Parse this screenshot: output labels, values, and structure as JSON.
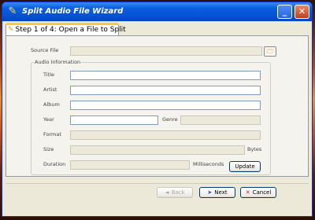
{
  "window": {
    "title": "Split Audio File Wizard",
    "controls": {
      "minimize": "_",
      "close": "✕"
    }
  },
  "tab": {
    "label": "Step 1 of 4:  Open a File to Split"
  },
  "source": {
    "label": "Source File",
    "value": ""
  },
  "audio_info": {
    "group_label": "Audio Information",
    "title_label": "Title",
    "title_value": "",
    "artist_label": "Artist",
    "artist_value": "",
    "album_label": "Album",
    "album_value": "",
    "year_label": "Year",
    "year_value": "",
    "genre_label": "Genre",
    "genre_value": "",
    "format_label": "Format",
    "format_value": "",
    "size_label": "Size",
    "size_value": "",
    "size_unit": "Bytes",
    "duration_label": "Duration",
    "duration_value": "",
    "duration_unit": "Milliseconds",
    "update_label": "Update"
  },
  "footer": {
    "back_label": "Back",
    "back_icon": "◄",
    "next_label": "Next",
    "next_icon": "➤",
    "cancel_label": "Cancel",
    "cancel_icon": "✕"
  },
  "colors": {
    "title_bar": "#0553d4",
    "window_bg": "#ece9d8",
    "tab_highlight": "#ffc83c",
    "cancel_icon": "#d0201c",
    "next_icon": "#1c4fb8"
  }
}
